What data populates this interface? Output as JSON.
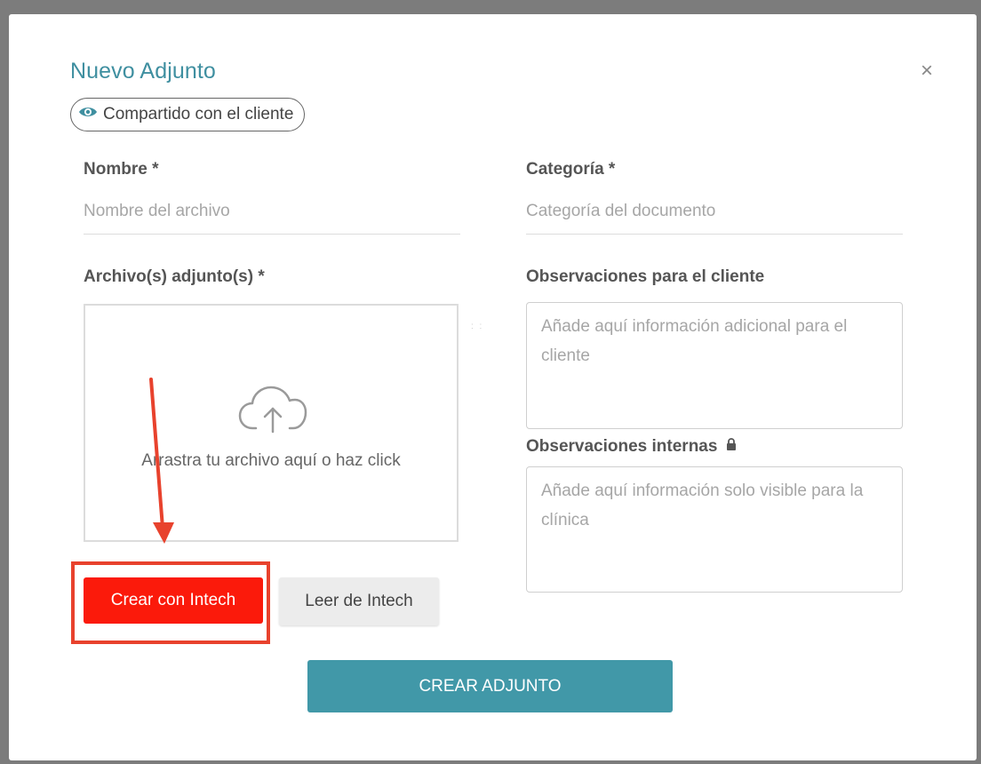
{
  "dialog": {
    "title": "Nuevo Adjunto",
    "close_symbol": "×",
    "shared_badge": "Compartido con el cliente"
  },
  "form": {
    "nombre": {
      "label": "Nombre *",
      "placeholder": "Nombre del archivo"
    },
    "categoria": {
      "label": "Categoría *",
      "placeholder": "Categoría del documento"
    },
    "archivos": {
      "label": "Archivo(s) adjunto(s) *",
      "dropzone_text": "Arrastra tu archivo aquí o haz click"
    },
    "obs_cliente": {
      "label": "Observaciones para el cliente",
      "placeholder": "Añade aquí información adicional para el cliente"
    },
    "obs_internas": {
      "label": "Observaciones internas",
      "placeholder": "Añade aquí información solo visible para la clínica"
    }
  },
  "buttons": {
    "crear_intech": "Crear con Intech",
    "leer_intech": "Leer de Intech",
    "crear_adjunto": "CREAR ADJUNTO"
  },
  "colors": {
    "accent": "#3f8fa0",
    "primary_button": "#4198a8",
    "danger_button": "#fb1a0b",
    "annotation": "#e8422d"
  },
  "icons": [
    "eye-icon",
    "close-icon",
    "cloud-upload-icon",
    "lock-icon",
    "arrow-annotation"
  ]
}
